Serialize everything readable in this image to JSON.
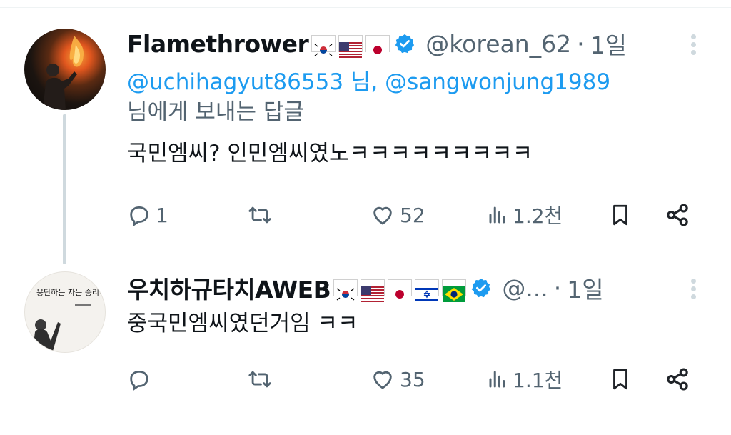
{
  "tweets": [
    {
      "name": "Flamethrower",
      "flags": [
        "kr",
        "us",
        "jp"
      ],
      "handle": "@korean_62",
      "time": "1일",
      "reply_line1": "@uchihagyut86553 님, @sangwonjung1989",
      "reply_line2": "님에게 보내는 답글",
      "text": "국민엠씨? 인민엠씨였노ㅋㅋㅋㅋㅋㅋㅋㅋㅋ",
      "replies": "1",
      "likes": "52",
      "views": "1.2천"
    },
    {
      "name": "우치하규타치AWEB",
      "flags": [
        "kr",
        "us",
        "jp",
        "il",
        "br"
      ],
      "handle": "@...",
      "time": "1일",
      "text": "중국민엠씨였던거임 ㅋㅋ",
      "replies": "",
      "likes": "35",
      "views": "1.1천",
      "avatar_text": "용단하는 자는 승리하지 못한다"
    }
  ],
  "colors": {
    "link": "#1d9bf0",
    "muted": "#536471",
    "verified": "#1d9bf0",
    "line": "#cfd9de"
  },
  "icons": [
    "reply-icon",
    "retweet-icon",
    "like-icon",
    "views-icon",
    "bookmark-icon",
    "share-icon",
    "verified-icon",
    "more-icon"
  ]
}
